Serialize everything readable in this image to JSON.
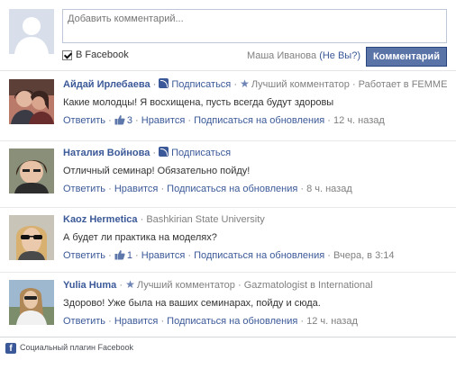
{
  "composer": {
    "placeholder": "Добавить комментарий...",
    "facebook_checkbox_label": "В Facebook",
    "posting_as_name": "Маша Иванова",
    "not_you_label": "(Не Вы?)",
    "submit_label": "Комментарий"
  },
  "comments": [
    {
      "author": "Айдай Ирлебаева",
      "subscribe": "Подписаться",
      "badge": "Лучший комментатор",
      "meta": " · Работает в FEMME",
      "text": "Какие молодцы! Я восхищена, пусть всегда будут здоровы",
      "reply": "Ответить",
      "like_count": "3",
      "like": "Нравится",
      "follow": "Подписаться на обновления",
      "time": "12 ч. назад"
    },
    {
      "author": "Наталия Войнова",
      "subscribe": "Подписаться",
      "text": "Отличный семинар! Обязательно пойду!",
      "reply": "Ответить",
      "like": "Нравится",
      "follow": "Подписаться на обновления",
      "time": "8 ч. назад"
    },
    {
      "author": "Kaoz Hermetica",
      "meta": "Bashkirian State University",
      "text": "А будет ли практика на моделях?",
      "reply": "Ответить",
      "like_count": "1",
      "like": "Нравится",
      "follow": "Подписаться на обновления",
      "time": "Вчера, в 3:14"
    },
    {
      "author": "Yulia Huma",
      "badge": "Лучший комментатор",
      "meta": "Gazmatologist в International",
      "text": "Здорово! Уже была на ваших семинарах, пойду и сюда.",
      "reply": "Ответить",
      "like": "Нравится",
      "follow": "Подписаться на обновления",
      "time": "12 ч. назад"
    }
  ],
  "footer": {
    "label": "Социальный плагин Facebook"
  }
}
